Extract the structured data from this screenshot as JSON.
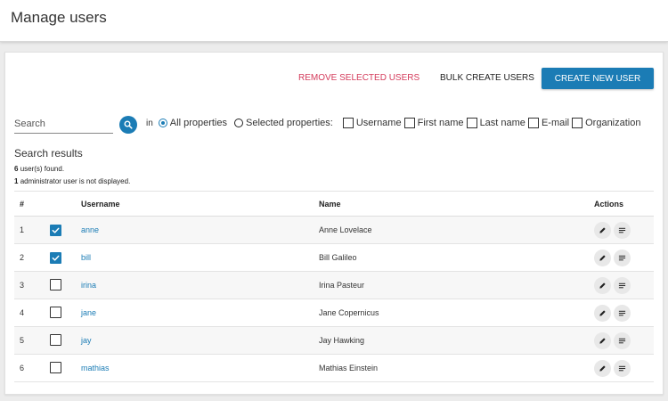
{
  "header": {
    "title": "Manage users"
  },
  "toolbar": {
    "remove_label": "REMOVE SELECTED USERS",
    "bulk_label": "BULK CREATE USERS",
    "create_label": "CREATE NEW USER"
  },
  "search": {
    "placeholder": "Search",
    "value": "",
    "in_label": "in",
    "all_label": "All properties",
    "selected_label": "Selected properties:",
    "properties": [
      "Username",
      "First name",
      "Last name",
      "E-mail",
      "Organization"
    ]
  },
  "results": {
    "title": "Search results",
    "count": "6",
    "count_suffix": "user(s) found.",
    "admin_count": "1",
    "admin_suffix": "administrator user is not displayed."
  },
  "table": {
    "headers": {
      "num": "#",
      "username": "Username",
      "name": "Name",
      "actions": "Actions"
    },
    "rows": [
      {
        "num": "1",
        "username": "anne",
        "name": "Anne Lovelace",
        "checked": true
      },
      {
        "num": "2",
        "username": "bill",
        "name": "Bill Galileo",
        "checked": true
      },
      {
        "num": "3",
        "username": "irina",
        "name": "Irina Pasteur",
        "checked": false
      },
      {
        "num": "4",
        "username": "jane",
        "name": "Jane Copernicus",
        "checked": false
      },
      {
        "num": "5",
        "username": "jay",
        "name": "Jay Hawking",
        "checked": false
      },
      {
        "num": "6",
        "username": "mathias",
        "name": "Mathias Einstein",
        "checked": false
      }
    ]
  },
  "icons": {
    "search": "search-icon",
    "edit": "pencil-icon",
    "details": "lines-icon",
    "check": "check-icon"
  },
  "colors": {
    "accent": "#1b7cb5",
    "danger": "#d43a5a"
  }
}
